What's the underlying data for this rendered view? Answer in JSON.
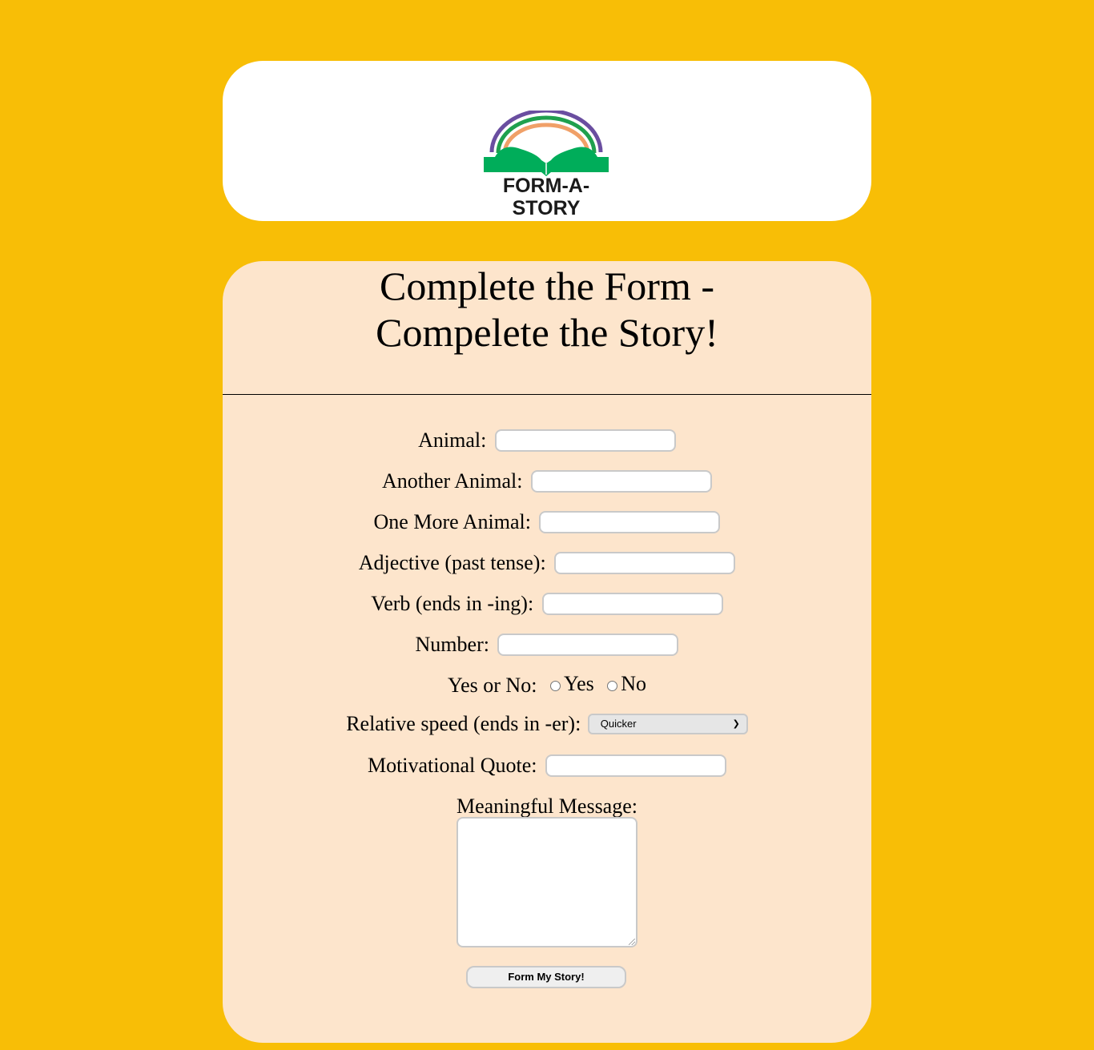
{
  "logo": {
    "text": "FORM-A-STORY",
    "icon": "rainbow-book-icon"
  },
  "form": {
    "title_line1": "Complete the Form -",
    "title_line2": "Compelete the Story!",
    "fields": {
      "animal": {
        "label": "Animal:",
        "value": ""
      },
      "another_animal": {
        "label": "Another Animal:",
        "value": ""
      },
      "one_more_animal": {
        "label": "One More Animal:",
        "value": ""
      },
      "adjective": {
        "label": "Adjective (past tense):",
        "value": ""
      },
      "verb": {
        "label": "Verb (ends in -ing):",
        "value": ""
      },
      "number": {
        "label": "Number:",
        "value": ""
      },
      "yes_no": {
        "label": "Yes or No:",
        "options": [
          "Yes",
          "No"
        ]
      },
      "relative_speed": {
        "label": "Relative speed (ends in -er):",
        "selected": "Quicker"
      },
      "quote": {
        "label": "Motivational Quote:",
        "value": ""
      },
      "message": {
        "label": "Meaningful Message:",
        "value": ""
      }
    },
    "submit_label": "Form My Story!"
  },
  "colors": {
    "background": "#f8be06",
    "header_card": "#ffffff",
    "form_card": "#fde5cc",
    "rainbow_purple": "#6a4ea0",
    "rainbow_green": "#1fa04e",
    "rainbow_orange": "#f0a068",
    "book_green": "#00ad5a"
  }
}
